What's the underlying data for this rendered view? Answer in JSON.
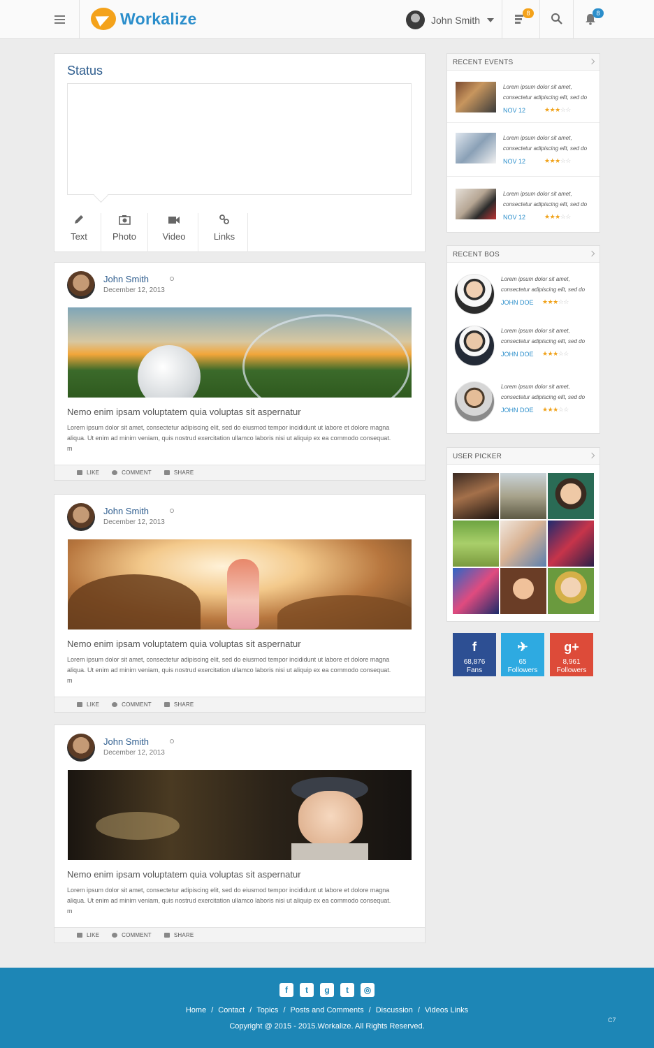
{
  "header": {
    "brand": "Workalize",
    "user_name": "John Smith",
    "inbox_count": "8",
    "notif_count": "8"
  },
  "status": {
    "title": "Status",
    "tabs": [
      {
        "label": "Text",
        "icon": "pencil-icon"
      },
      {
        "label": "Photo",
        "icon": "camera-icon"
      },
      {
        "label": "Video",
        "icon": "video-camera-icon"
      },
      {
        "label": "Links",
        "icon": "link-icon"
      }
    ]
  },
  "posts": [
    {
      "author": "John Smith",
      "date": "December 12, 2013",
      "heading": "Nemo enim ipsam voluptatem quia voluptas sit aspernatur",
      "body": "Lorem ipsum dolor sit amet, consectetur adipiscing elit, sed do eiusmod tempor incididunt ut labore et dolore magna aliqua. Ut enim ad minim veniam, quis nostrud exercitation ullamco laboris nisi ut aliquip ex ea commodo consequat. m"
    },
    {
      "author": "John Smith",
      "date": "December 12, 2013",
      "heading": "Nemo enim ipsam voluptatem quia voluptas sit aspernatur",
      "body": "Lorem ipsum dolor sit amet, consectetur adipiscing elit, sed do eiusmod tempor incididunt ut labore et dolore magna aliqua. Ut enim ad minim veniam, quis nostrud exercitation ullamco laboris nisi ut aliquip ex ea commodo consequat. m"
    },
    {
      "author": "John Smith",
      "date": "December 12, 2013",
      "heading": "Nemo enim ipsam voluptatem quia voluptas sit aspernatur",
      "body": "Lorem ipsum dolor sit amet, consectetur adipiscing elit, sed do eiusmod tempor incididunt ut labore et dolore magna aliqua. Ut enim ad minim veniam, quis nostrud exercitation ullamco laboris nisi ut aliquip ex ea commodo consequat. m"
    }
  ],
  "post_actions": {
    "like": "LIKE",
    "comment": "COMMENT",
    "share": "SHARE"
  },
  "recent_events": {
    "title": "RECENT EVENTS",
    "items": [
      {
        "text": "Lorem ipsum dolor sit amet, consectetur adipiscing elit, sed do",
        "date": "NOV 12",
        "rating": 3
      },
      {
        "text": "Lorem ipsum dolor sit amet, consectetur adipiscing elit, sed do",
        "date": "NOV 12",
        "rating": 3
      },
      {
        "text": "Lorem ipsum dolor sit amet, consectetur adipiscing elit, sed do",
        "date": "NOV 12",
        "rating": 3
      }
    ]
  },
  "recent_bos": {
    "title": "RECENT BOS",
    "items": [
      {
        "text": "Lorem ipsum dolor sit amet, consectetur adipiscing elit, sed do",
        "name": "JOHN DOE",
        "rating": 3
      },
      {
        "text": "Lorem ipsum dolor sit amet, consectetur adipiscing elit, sed do",
        "name": "JOHN DOE",
        "rating": 3
      },
      {
        "text": "Lorem ipsum dolor sit amet, consectetur adipiscing elit, sed do",
        "name": "JOHN DOE",
        "rating": 3
      }
    ]
  },
  "user_picker": {
    "title": "USER PICKER"
  },
  "social": [
    {
      "network": "facebook",
      "count": "68,876",
      "label": "Fans",
      "color": "#2d4f93"
    },
    {
      "network": "twitter",
      "count": "65",
      "label": "Followers",
      "color": "#2eaae1"
    },
    {
      "network": "google-plus",
      "count": "8,961",
      "label": "Followers",
      "color": "#dd4b39"
    }
  ],
  "footer": {
    "links": [
      "Home",
      "Contact",
      "Topics",
      "Posts and Comments",
      "Discussion",
      "Videos Links"
    ],
    "copyright": "Copyright @ 2015 - 2015.Workalize. All Rights Reserved.",
    "mark": "C7"
  }
}
